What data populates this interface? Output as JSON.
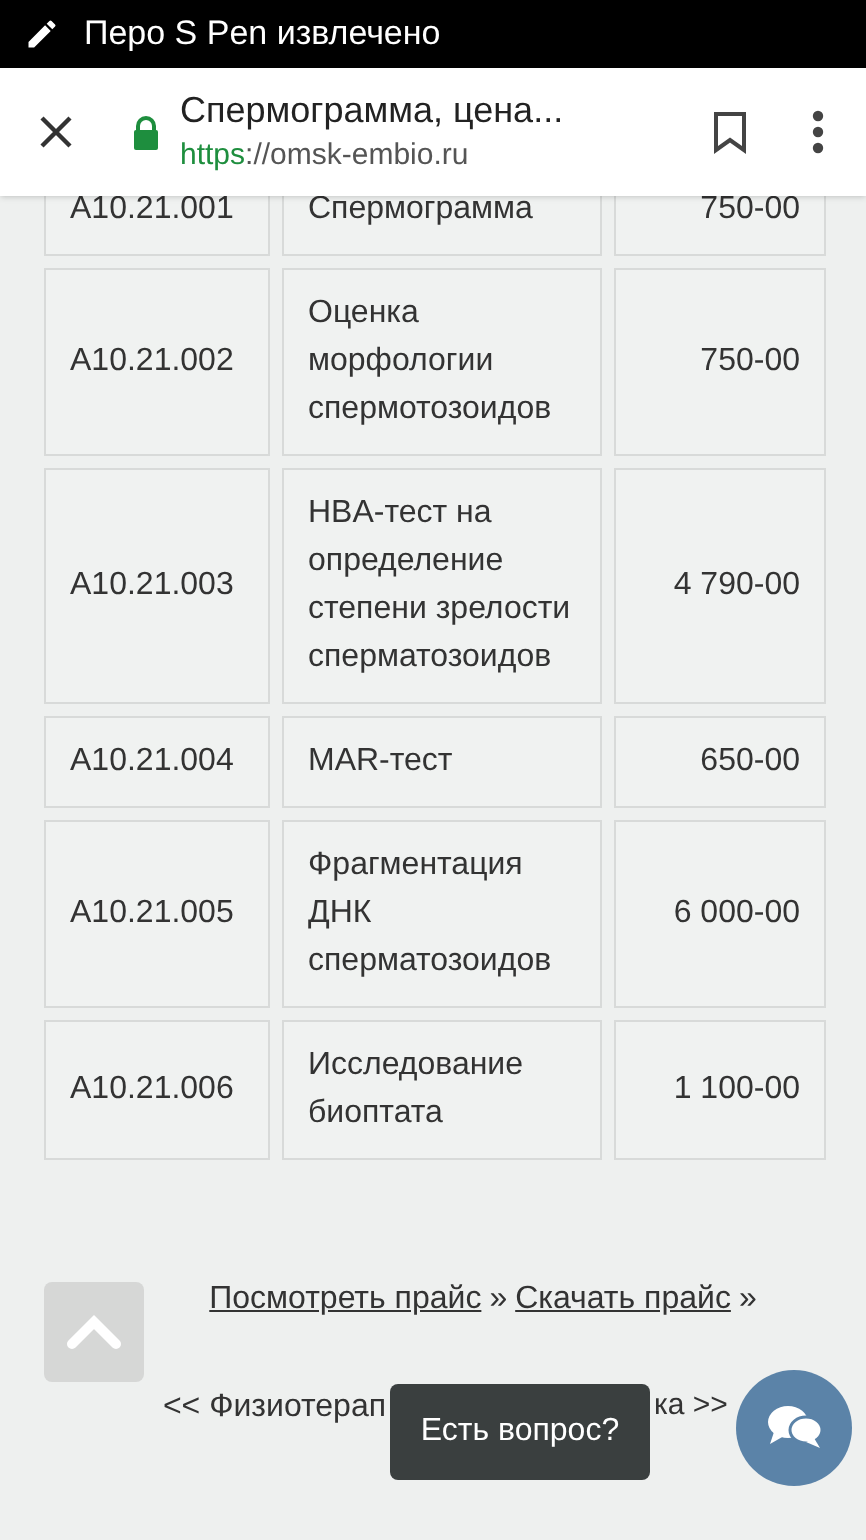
{
  "status_bar": {
    "text": "Перо S Pen извлечено"
  },
  "browser": {
    "title": "Спермограмма, цена...",
    "url_scheme": "https",
    "url_rest": "://omsk-embio.ru"
  },
  "table": {
    "rows": [
      {
        "code": "A10.21.001",
        "name": "Спермограмма",
        "price": "750-00"
      },
      {
        "code": "A10.21.002",
        "name": "Оценка морфологии спермотозоидов",
        "price": "750-00"
      },
      {
        "code": "A10.21.003",
        "name": "HBA-тест на определение степени зрелости сперматозоидов",
        "price": "4 790-00"
      },
      {
        "code": "A10.21.004",
        "name": "MAR-тест",
        "price": "650-00"
      },
      {
        "code": "A10.21.005",
        "name": "Фрагментация ДНК сперматозоидов",
        "price": "6 000-00"
      },
      {
        "code": "A10.21.006",
        "name": "Исследование биоптата",
        "price": "1 100-00"
      }
    ]
  },
  "price_links": [
    {
      "label": "Посмотреть прайс",
      "after": "»"
    },
    {
      "label": "Скачать прайс",
      "after": "»"
    }
  ],
  "nav": {
    "prev": "<< Физиотерап",
    "next": "ка >>"
  },
  "chat": {
    "tooltip": "Есть вопрос?"
  }
}
